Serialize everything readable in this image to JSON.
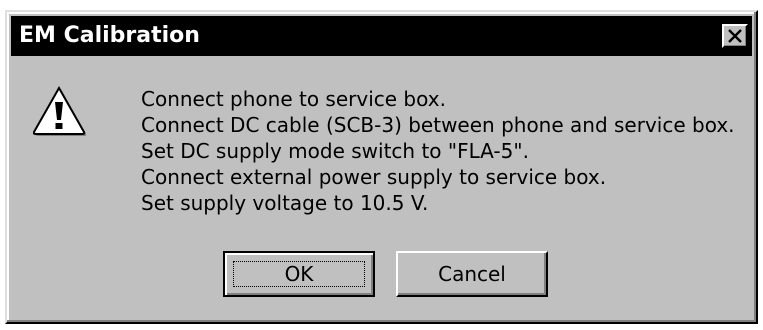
{
  "window": {
    "title": "EM Calibration"
  },
  "icon": {
    "type": "warning-icon"
  },
  "message": {
    "lines": [
      "Connect phone to service box.",
      "Connect DC cable (SCB-3) between phone and service box.",
      "Set DC supply mode switch to \"FLA-5\".",
      "Connect external power supply to service box.",
      "Set supply voltage to 10.5 V."
    ]
  },
  "buttons": {
    "ok_label": "OK",
    "cancel_label": "Cancel"
  },
  "colors": {
    "titlebar": "#000000",
    "title_text": "#ffffff",
    "face": "#c0c0c0"
  }
}
